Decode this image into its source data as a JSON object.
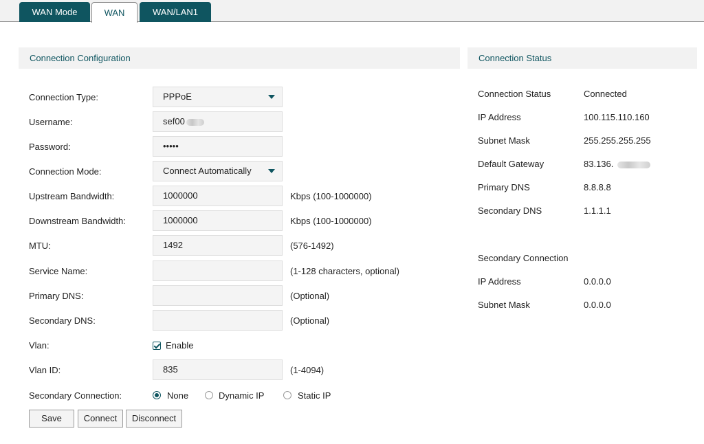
{
  "tabs": [
    {
      "label": "WAN Mode"
    },
    {
      "label": "WAN"
    },
    {
      "label": "WAN/LAN1"
    }
  ],
  "config": {
    "title": "Connection Configuration",
    "connection_type_label": "Connection Type:",
    "connection_type_value": "PPPoE",
    "username_label": "Username:",
    "username_value": "sef00",
    "password_label": "Password:",
    "password_value": "•••••",
    "connection_mode_label": "Connection Mode:",
    "connection_mode_value": "Connect Automatically",
    "upstream_label": "Upstream Bandwidth:",
    "upstream_value": "1000000",
    "upstream_hint": "Kbps (100-1000000)",
    "downstream_label": "Downstream Bandwidth:",
    "downstream_value": "1000000",
    "downstream_hint": "Kbps (100-1000000)",
    "mtu_label": "MTU:",
    "mtu_value": "1492",
    "mtu_hint": "(576-1492)",
    "service_label": "Service Name:",
    "service_value": "",
    "service_hint": "(1-128 characters, optional)",
    "primary_dns_label": "Primary DNS:",
    "primary_dns_value": "",
    "primary_dns_hint": "(Optional)",
    "secondary_dns_label": "Secondary DNS:",
    "secondary_dns_value": "",
    "secondary_dns_hint": "(Optional)",
    "vlan_label": "Vlan:",
    "vlan_enable_label": "Enable",
    "vlan_id_label": "Vlan ID:",
    "vlan_id_value": "835",
    "vlan_id_hint": "(1-4094)",
    "secondary_conn_label": "Secondary Connection:",
    "secondary_options": [
      "None",
      "Dynamic IP",
      "Static IP"
    ],
    "save_label": "Save",
    "connect_label": "Connect",
    "disconnect_label": "Disconnect"
  },
  "status": {
    "title": "Connection Status",
    "rows": [
      {
        "label": "Connection Status",
        "value": "Connected"
      },
      {
        "label": "IP Address",
        "value": "100.115.110.160"
      },
      {
        "label": "Subnet Mask",
        "value": "255.255.255.255"
      },
      {
        "label": "Default Gateway",
        "value": "83.136."
      },
      {
        "label": "Primary DNS",
        "value": "8.8.8.8"
      },
      {
        "label": "Secondary DNS",
        "value": "1.1.1.1"
      }
    ],
    "secondary_title": "Secondary Connection",
    "secondary_rows": [
      {
        "label": "IP Address",
        "value": "0.0.0.0"
      },
      {
        "label": "Subnet Mask",
        "value": "0.0.0.0"
      }
    ]
  },
  "colors": {
    "accent": "#0f5560",
    "panel_bg": "#f2f2f2",
    "field_bg": "#f4f4f4"
  }
}
